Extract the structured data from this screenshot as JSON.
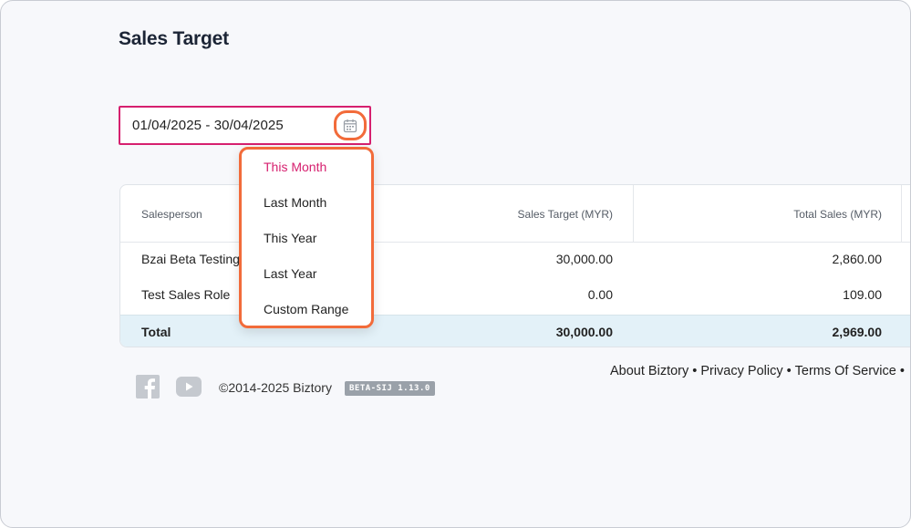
{
  "page": {
    "title": "Sales Target"
  },
  "date_filter": {
    "value": "01/04/2025 - 30/04/2025",
    "icon": "calendar-icon"
  },
  "dropdown": {
    "items": [
      {
        "label": "This Month",
        "active": true
      },
      {
        "label": "Last Month",
        "active": false
      },
      {
        "label": "This Year",
        "active": false
      },
      {
        "label": "Last Year",
        "active": false
      },
      {
        "label": "Custom Range",
        "active": false
      }
    ]
  },
  "table": {
    "columns": [
      "Salesperson",
      "Sales Target (MYR)",
      "Total Sales (MYR)"
    ],
    "rows": [
      {
        "salesperson": "Bzai Beta Testing",
        "target": "30,000.00",
        "sales": "2,860.00"
      },
      {
        "salesperson": "Test Sales Role",
        "target": "0.00",
        "sales": "109.00"
      }
    ],
    "total": {
      "label": "Total",
      "target": "30,000.00",
      "sales": "2,969.00"
    }
  },
  "footer": {
    "copyright": "©2014-2025 Biztory",
    "version": "BETA-SIJ 1.13.0",
    "links": [
      "About Biztory",
      "Privacy Policy",
      "Terms Of Service"
    ],
    "icons": [
      "facebook-icon",
      "youtube-icon"
    ]
  },
  "colors": {
    "accent": "#d6206f",
    "highlight": "#f26b3a",
    "total_row": "#e3f1f8"
  }
}
